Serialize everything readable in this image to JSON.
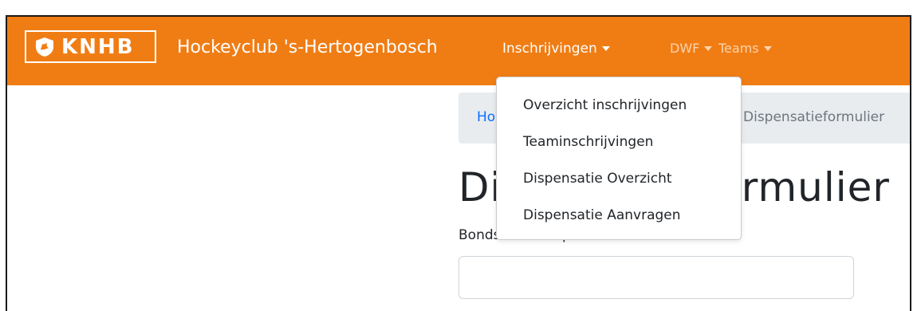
{
  "navbar": {
    "logo_text": "KNHB",
    "club_name": "Hockeyclub 's-Hertogenbosch",
    "menu": [
      {
        "label": "Inschrijvingen"
      },
      {
        "label": "DWF"
      },
      {
        "label": "Teams"
      }
    ],
    "background_color": "#f07d14"
  },
  "dropdown": {
    "items": [
      {
        "label": "Overzicht inschrijvingen"
      },
      {
        "label": "Teaminschrijvingen"
      },
      {
        "label": "Dispensatie Overzicht"
      },
      {
        "label": "Dispensatie Aanvragen"
      }
    ]
  },
  "breadcrumb": {
    "home": "Ho",
    "current": "Dispensatieformulier"
  },
  "main": {
    "title": "Dispensatieformulier",
    "field_label": "Bondsnummer persoon",
    "field_value": ""
  },
  "colors": {
    "accent": "#f07d14",
    "link": "#0d6efd"
  }
}
